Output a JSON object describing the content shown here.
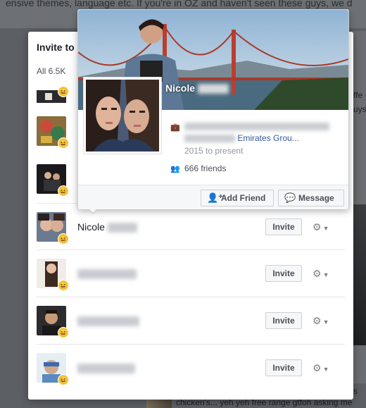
{
  "background": {
    "top_text": "ensive themes, language etc. If you're in OZ and haven't seen these guys, we d",
    "right_text_1": "ffe",
    "right_text_2": "uys",
    "right_text_3": "s",
    "bottom_text": "chicken's... yeh yeh free range gtfoh asking me"
  },
  "dialog": {
    "title": "Invite to",
    "tab_label": "All 6.5K",
    "rows": [
      {
        "name": "Nicole",
        "invite_label": "Invite"
      },
      {
        "name": "",
        "invite_label": "Invite"
      },
      {
        "name": "",
        "invite_label": "Invite"
      },
      {
        "name": "",
        "invite_label": "Invite"
      }
    ]
  },
  "hovercard": {
    "name": "Nicole",
    "employer_link": "Emirates Grou...",
    "since": "2015 to present",
    "friends": "666 friends",
    "add_friend_label": "Add Friend",
    "message_label": "Message"
  },
  "colors": {
    "link": "#365899",
    "emoji": "#f7c33b"
  },
  "icons": {
    "work": "briefcase-icon",
    "friends": "friends-icon",
    "add_friend": "add-friend-icon",
    "message": "messenger-icon",
    "row_settings": "gear-icon",
    "reaction": "laughing-emoji-icon"
  }
}
